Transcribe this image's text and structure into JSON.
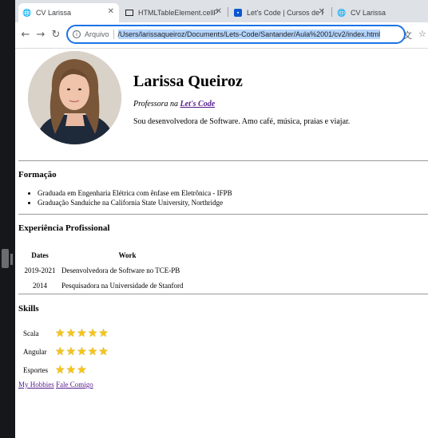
{
  "browser": {
    "tabs": [
      {
        "title": "CV Larissa",
        "icon": "globe-icon",
        "active": true
      },
      {
        "title": "HTMLTableElement.cellPadd",
        "icon": "mdn-icon",
        "active": false
      },
      {
        "title": "Let's Code | Cursos de Prog",
        "icon": "letscode-icon",
        "active": false
      },
      {
        "title": "CV Larissa",
        "icon": "globe-icon",
        "active": false
      }
    ],
    "scheme_label": "Arquivo",
    "url": "/Users/larissaqueiroz/Documents/Lets-Code/Santander/Aula%2001/cv2/index.html"
  },
  "profile": {
    "name": "Larissa Queiroz",
    "role_prefix": "Professora na",
    "role_link": "Let's Code",
    "bio": "Sou desenvolvedora de Software. Amo café, música, praias e viajar."
  },
  "education": {
    "heading": "Formação",
    "items": [
      "Graduada em Engenharia Elétrica com ênfase em Eletrônica - IFPB",
      "Graduação Sanduíche na California State University, Northridge"
    ]
  },
  "experience": {
    "heading": "Experiência Profissional",
    "columns": [
      "Dates",
      "Work"
    ],
    "rows": [
      [
        "2019-2021",
        "Desenvolvedora de Software no TCE-PB"
      ],
      [
        "2014",
        "Pesquisadora na Universidade de Stanford"
      ]
    ]
  },
  "skills": {
    "heading": "Skills",
    "items": [
      {
        "name": "Scala",
        "stars": 5
      },
      {
        "name": "Angular",
        "stars": 5
      },
      {
        "name": "Esportes",
        "stars": 3
      }
    ]
  },
  "footer_links": [
    "My Hobbies",
    "Fale Comigo"
  ]
}
